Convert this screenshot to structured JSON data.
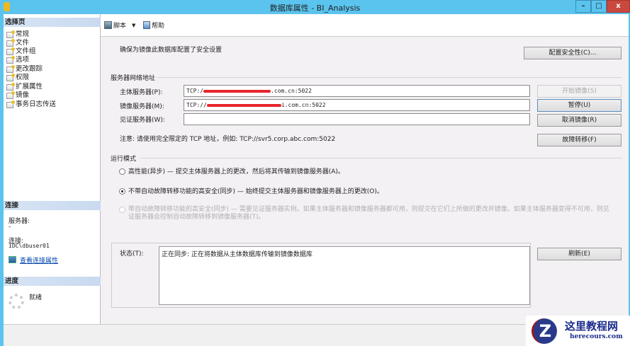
{
  "window": {
    "title": "数据库属性 - BI_Analysis",
    "minimize": "–",
    "maximize": "□",
    "close": "x"
  },
  "sidebar": {
    "header": "选择页",
    "items": [
      {
        "label": "常规"
      },
      {
        "label": "文件"
      },
      {
        "label": "文件组"
      },
      {
        "label": "选项"
      },
      {
        "label": "更改跟踪"
      },
      {
        "label": "权限"
      },
      {
        "label": "扩展属性"
      },
      {
        "label": "镜像"
      },
      {
        "label": "事务日志传送"
      }
    ]
  },
  "connection": {
    "header": "连接",
    "server_label": "服务器:",
    "server_value": "-",
    "conn_label": "连接:",
    "conn_value": "IDC\\dbuser01",
    "link": "查看连接属性"
  },
  "progress": {
    "header": "进度",
    "status": "就绪"
  },
  "toolbar": {
    "script": "脚本",
    "help": "帮助"
  },
  "main": {
    "security_text": "确保为镜像此数据库配置了安全设置",
    "configure_button": "配置安全性(C)...",
    "network_group": "服务器网络地址",
    "principal_label": "主体服务器(P):",
    "principal_prefix": "TCP:/",
    "principal_suffix": ".com.cn:5022",
    "mirror_label": "镜像服务器(M):",
    "mirror_prefix": "TCP://",
    "mirror_suffix": "i.com.cn:5022",
    "witness_label": "见证服务器(W):",
    "witness_value": "",
    "start_button": "开始镜像(S)",
    "pause_button": "暂停(U)",
    "remove_button": "取消镜像(R)",
    "failover_button": "故障转移(F)",
    "note": "注意: 请使用完全限定的 TCP 地址，例如: TCP://svr5.corp.abc.com:5022",
    "mode_group": "运行模式",
    "mode_high_perf": "高性能(异步) — 提交主体服务器上的更改，然后将其传输到镜像服务器(A)。",
    "mode_high_safety": "不带自动故障转移功能的高安全(同步) — 始终提交主体服务器和镜像服务器上的更改(O)。",
    "mode_auto_failover": "带自动故障转移功能的高安全(同步) — 需要见证服务器实例。如果主体服务器和镜像服务器都可用，则提交在它们上所做的更改并镜像。如果主体服务器变得不可用，则见证服务器会控制自动故障转移到镜像服务器(T)。",
    "status_label": "状态(T):",
    "status_value": "正在同步: 正在将数据从主体数据库传输到镜像数据库",
    "refresh_button": "刷新(E)"
  },
  "watermark": {
    "title": "这里教程网",
    "url": "herecours.com"
  }
}
